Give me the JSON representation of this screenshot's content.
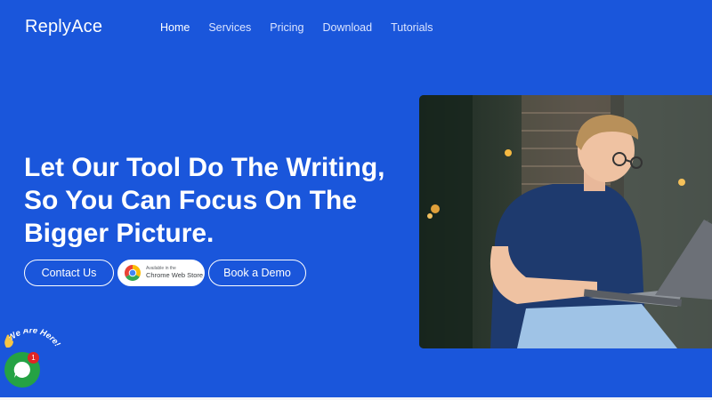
{
  "navbar": {
    "brand": "ReplyAce",
    "links": [
      {
        "label": "Home",
        "active": true
      },
      {
        "label": "Services",
        "active": false
      },
      {
        "label": "Pricing",
        "active": false
      },
      {
        "label": "Download",
        "active": false
      },
      {
        "label": "Tutorials",
        "active": false
      }
    ]
  },
  "hero": {
    "title_lines": [
      "Let Our Tool Do The Writing,",
      "So You Can Focus On The",
      "Bigger Picture."
    ],
    "contact_button": "Contact Us",
    "chrome_badge": {
      "small_text": "Available in the",
      "big_text": "Chrome Web Store",
      "icon": "chrome-icon"
    },
    "demo_button": "Book a Demo"
  },
  "chat_widget": {
    "tagline": "We Are Here!",
    "wave_icon": "waving-hand-icon",
    "chat_icon": "chat-bubble-icon",
    "unread_count": "1"
  },
  "colors": {
    "background": "#1a56db",
    "text": "#ffffff",
    "chat_green": "#25a244",
    "badge_red": "#e02424"
  }
}
